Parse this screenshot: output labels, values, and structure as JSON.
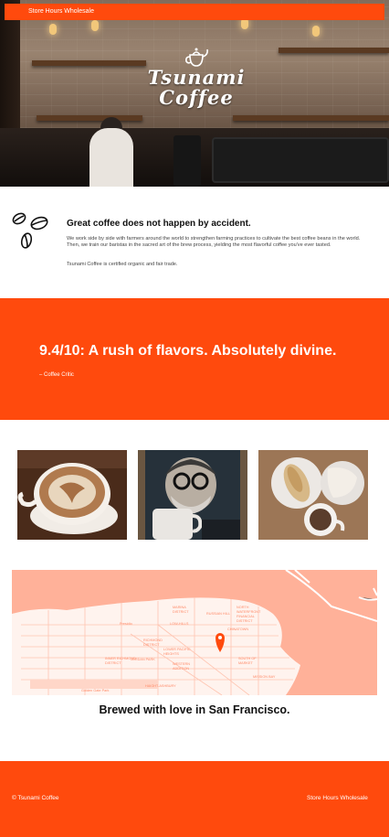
{
  "nav": {
    "link_text": "Store Hours Wholesale"
  },
  "hero": {
    "logo_line1": "Tsunami",
    "logo_line2": "Coffee",
    "logo_icon": "teapot-icon"
  },
  "intro": {
    "icon": "coffee-beans-icon",
    "heading": "Great coffee does not happen by accident.",
    "body": "We work side by side with farmers around the world to strengthen farming practices to cultivate the best coffee beans in the world. Then, we train our baristas in the sacred art of the brew process, yielding the most flavorful coffee you've ever tasted.",
    "certification": "Tsunami Coffee is certified organic and fair trade."
  },
  "quote": {
    "text": "9.4/10: A rush of flavors. Absolutely divine.",
    "author": "– Coffee Critic"
  },
  "photos": [
    {
      "subject": "latte-art-cup"
    },
    {
      "subject": "man-drinking-coffee"
    },
    {
      "subject": "coffee-and-pastries"
    }
  ],
  "map": {
    "icon": "location-pin-icon",
    "labels": [
      "MARINA DISTRICT",
      "LOW-HILLS",
      "Presidio",
      "RUSSIAN HILL",
      "NORTH WATERFRONT",
      "FINANCIAL DISTRICT",
      "CHINATOWN",
      "RICHMOND DISTRICT",
      "JORDAN PARK",
      "LOWER PACIFIC HEIGHTS",
      "WESTERN ADDITION",
      "SOUTH OF MARKET",
      "HAIGHT-ASHBURY",
      "MISSION BAY",
      "Golden Gate Park",
      "INNER RICHMOND"
    ],
    "caption": "Brewed with love in San Francisco.",
    "water_color": "#ffb199",
    "land_color": "#ffffff"
  },
  "footer": {
    "copyright": "© Tsunami Coffee",
    "link_text": "Store Hours Wholesale"
  },
  "colors": {
    "brand_orange": "#ff4a0d",
    "text_dark": "#111111"
  }
}
